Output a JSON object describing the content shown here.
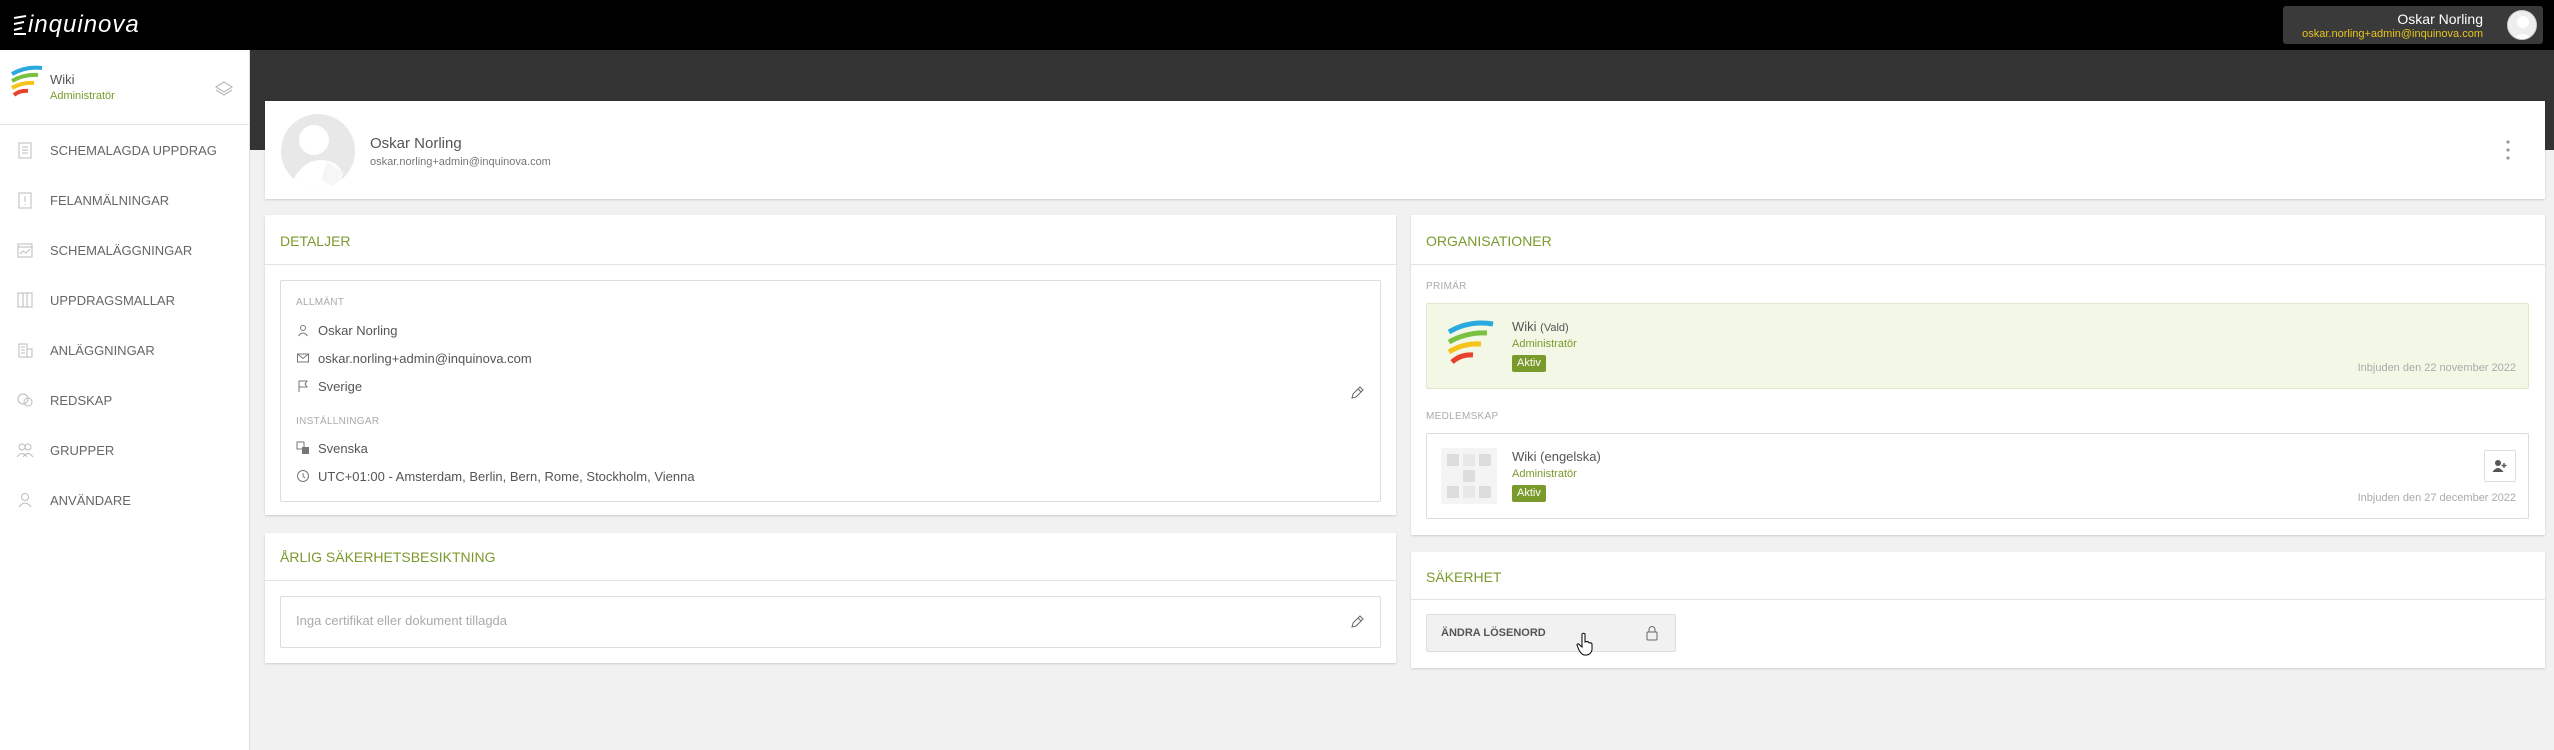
{
  "brand": {
    "logo_text": "inquinova",
    "accent": "#7a9a2c",
    "topbar_bg": "#000000",
    "email_color": "#e8c51a"
  },
  "user": {
    "name": "Oskar Norling",
    "email": "oskar.norling+admin@inquinova.com"
  },
  "org": {
    "name": "Wiki",
    "role": "Administratör"
  },
  "sidebar": {
    "items": [
      {
        "label": "SCHEMALAGDA UPPDRAG",
        "icon": "clipboard-icon"
      },
      {
        "label": "FELANMÄLNINGAR",
        "icon": "alert-file-icon"
      },
      {
        "label": "SCHEMALÄGGNINGAR",
        "icon": "calendar-chart-icon"
      },
      {
        "label": "UPPDRAGSMALLAR",
        "icon": "columns-icon"
      },
      {
        "label": "ANLÄGGNINGAR",
        "icon": "building-icon"
      },
      {
        "label": "REDSKAP",
        "icon": "tools-icon"
      },
      {
        "label": "GRUPPER",
        "icon": "group-icon"
      },
      {
        "label": "ANVÄNDARE",
        "icon": "user-icon"
      }
    ]
  },
  "profile": {
    "name": "Oskar Norling",
    "email": "oskar.norling+admin@inquinova.com"
  },
  "details": {
    "title": "DETALJER",
    "general_label": "ALLMÄNT",
    "name": "Oskar Norling",
    "email": "oskar.norling+admin@inquinova.com",
    "country": "Sverige",
    "settings_label": "INSTÄLLNINGAR",
    "language": "Svenska",
    "timezone": "UTC+01:00 - Amsterdam, Berlin, Bern, Rome, Stockholm, Vienna"
  },
  "annual": {
    "title": "ÅRLIG SÄKERHETSBESIKTNING",
    "empty": "Inga certifikat eller dokument tillagda"
  },
  "organisations": {
    "title": "ORGANISATIONER",
    "primary_label": "PRIMÄR",
    "primary": {
      "name": "Wiki",
      "selected": "(Vald)",
      "role": "Administratör",
      "status": "Aktiv",
      "invited": "Inbjuden den 22 november 2022"
    },
    "membership_label": "MEDLEMSKAP",
    "memberships": [
      {
        "name": "Wiki (engelska)",
        "role": "Administratör",
        "status": "Aktiv",
        "invited": "Inbjuden den 27 december 2022"
      }
    ]
  },
  "security": {
    "title": "SÄKERHET",
    "change_password": "ÄNDRA LÖSENORD"
  }
}
